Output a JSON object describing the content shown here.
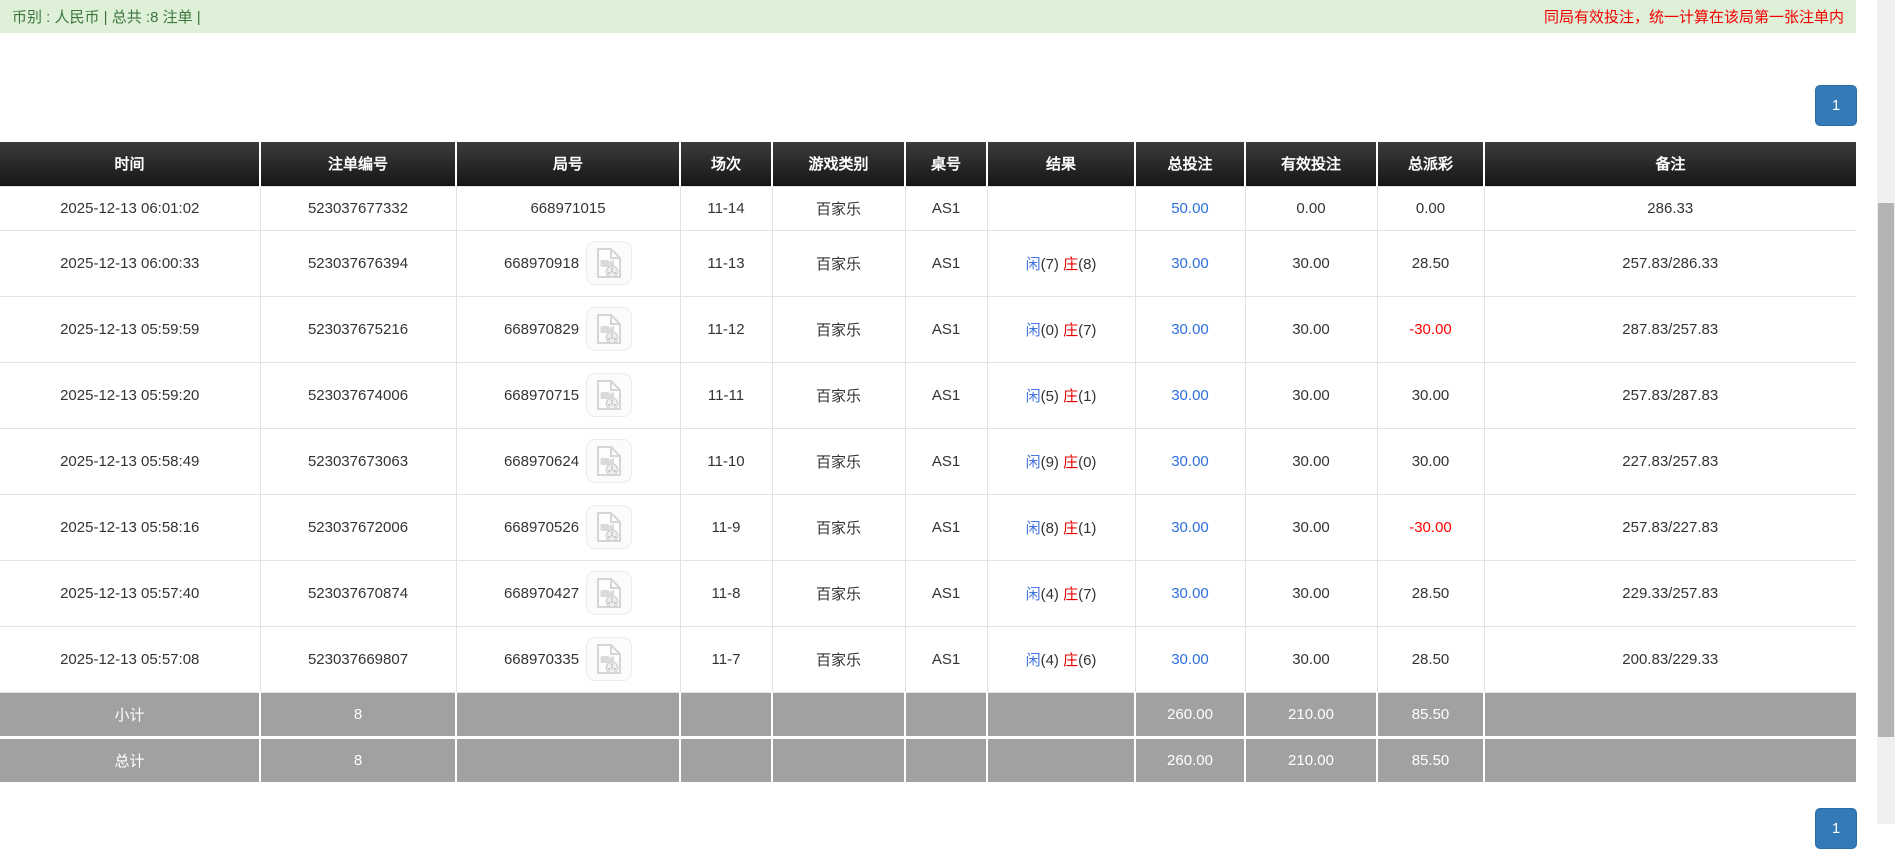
{
  "topbar": {
    "left": "币别 : 人民币 | 总共 :8 注单 |",
    "right": "同局有效投注，统一计算在该局第一张注单内"
  },
  "pagination": {
    "current_page": "1"
  },
  "table": {
    "columns": {
      "time": "时间",
      "bet_id": "注单编号",
      "round": "局号",
      "session": "场次",
      "game_type": "游戏类别",
      "table_no": "桌号",
      "result": "结果",
      "total_bet": "总投注",
      "valid_bet": "有效投注",
      "payout": "总派彩",
      "remark": "备注"
    },
    "rows": [
      {
        "time": "2025-12-13 06:01:02",
        "bet_id": "523037677332",
        "round": "668971015",
        "has_video": false,
        "session": "11-14",
        "game_type": "百家乐",
        "table_no": "AS1",
        "result_player": "",
        "result_player_score": "",
        "result_banker": "",
        "result_banker_score": "",
        "total_bet": "50.00",
        "valid_bet": "0.00",
        "payout": "0.00",
        "remark": "286.33"
      },
      {
        "time": "2025-12-13 06:00:33",
        "bet_id": "523037676394",
        "round": "668970918",
        "has_video": true,
        "session": "11-13",
        "game_type": "百家乐",
        "table_no": "AS1",
        "result_player": "闲",
        "result_player_score": "(7) ",
        "result_banker": "庄",
        "result_banker_score": "(8)",
        "total_bet": "30.00",
        "valid_bet": "30.00",
        "payout": "28.50",
        "remark": "257.83/286.33"
      },
      {
        "time": "2025-12-13 05:59:59",
        "bet_id": "523037675216",
        "round": "668970829",
        "has_video": true,
        "session": "11-12",
        "game_type": "百家乐",
        "table_no": "AS1",
        "result_player": "闲",
        "result_player_score": "(0) ",
        "result_banker": "庄",
        "result_banker_score": "(7)",
        "total_bet": "30.00",
        "valid_bet": "30.00",
        "payout": "-30.00",
        "remark": "287.83/257.83"
      },
      {
        "time": "2025-12-13 05:59:20",
        "bet_id": "523037674006",
        "round": "668970715",
        "has_video": true,
        "session": "11-11",
        "game_type": "百家乐",
        "table_no": "AS1",
        "result_player": "闲",
        "result_player_score": "(5) ",
        "result_banker": "庄",
        "result_banker_score": "(1)",
        "total_bet": "30.00",
        "valid_bet": "30.00",
        "payout": "30.00",
        "remark": "257.83/287.83"
      },
      {
        "time": "2025-12-13 05:58:49",
        "bet_id": "523037673063",
        "round": "668970624",
        "has_video": true,
        "session": "11-10",
        "game_type": "百家乐",
        "table_no": "AS1",
        "result_player": "闲",
        "result_player_score": "(9) ",
        "result_banker": "庄",
        "result_banker_score": "(0)",
        "total_bet": "30.00",
        "valid_bet": "30.00",
        "payout": "30.00",
        "remark": "227.83/257.83"
      },
      {
        "time": "2025-12-13 05:58:16",
        "bet_id": "523037672006",
        "round": "668970526",
        "has_video": true,
        "session": "11-9",
        "game_type": "百家乐",
        "table_no": "AS1",
        "result_player": "闲",
        "result_player_score": "(8) ",
        "result_banker": "庄",
        "result_banker_score": "(1)",
        "total_bet": "30.00",
        "valid_bet": "30.00",
        "payout": "-30.00",
        "remark": "257.83/227.83"
      },
      {
        "time": "2025-12-13 05:57:40",
        "bet_id": "523037670874",
        "round": "668970427",
        "has_video": true,
        "session": "11-8",
        "game_type": "百家乐",
        "table_no": "AS1",
        "result_player": "闲",
        "result_player_score": "(4) ",
        "result_banker": "庄",
        "result_banker_score": "(7)",
        "total_bet": "30.00",
        "valid_bet": "30.00",
        "payout": "28.50",
        "remark": "229.33/257.83"
      },
      {
        "time": "2025-12-13 05:57:08",
        "bet_id": "523037669807",
        "round": "668970335",
        "has_video": true,
        "session": "11-7",
        "game_type": "百家乐",
        "table_no": "AS1",
        "result_player": "闲",
        "result_player_score": "(4) ",
        "result_banker": "庄",
        "result_banker_score": "(6)",
        "total_bet": "30.00",
        "valid_bet": "30.00",
        "payout": "28.50",
        "remark": "200.83/229.33"
      }
    ],
    "subtotal": {
      "label": "小计",
      "count": "8",
      "total_bet": "260.00",
      "valid_bet": "210.00",
      "payout": "85.50"
    },
    "grand_total": {
      "label": "总计",
      "count": "8",
      "total_bet": "260.00",
      "valid_bet": "210.00",
      "payout": "85.50"
    }
  },
  "icons": {
    "video": "video-icon"
  },
  "colors": {
    "topbar_bg": "#dff0d8",
    "topbar_text": "#3c763d",
    "notice_red": "#f20000",
    "link_blue": "#2e6fdf",
    "player_blue": "#4272e0",
    "banker_red": "#e60000",
    "negative_red": "#ff0000",
    "header_bg": "#1b1b1b",
    "summary_row_bg": "#a1a1a1",
    "pagination_blue": "#337ab7"
  }
}
